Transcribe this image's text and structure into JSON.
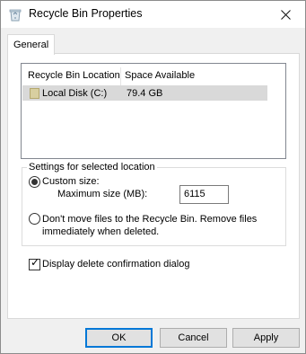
{
  "window": {
    "title": "Recycle Bin Properties"
  },
  "tabs": [
    {
      "label": "General"
    }
  ],
  "locations": {
    "columns": [
      "Recycle Bin Location",
      "Space Available"
    ],
    "rows": [
      {
        "location": "Local Disk (C:)",
        "space": "79.4 GB"
      }
    ]
  },
  "settings": {
    "group_label": "Settings for selected location",
    "custom_size_label": "Custom size:",
    "max_size_label": "Maximum size (MB):",
    "max_size_value": "6115",
    "no_move_label": "Don't move files to the Recycle Bin. Remove files immediately when deleted.",
    "confirm_label": "Display delete confirmation dialog",
    "custom_size_selected": true,
    "confirm_checked": true
  },
  "buttons": {
    "ok": "OK",
    "cancel": "Cancel",
    "apply": "Apply"
  },
  "icons": {
    "title": "recycle-bin-icon",
    "close": "close-icon",
    "drive": "drive-icon"
  },
  "colors": {
    "accent": "#0078d7",
    "selected_row": "#d9d9d9"
  }
}
